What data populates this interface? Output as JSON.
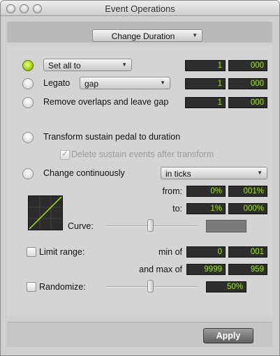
{
  "window": {
    "title": "Event Operations"
  },
  "operation": {
    "selected": "Change Duration"
  },
  "options": {
    "set_all_to": {
      "label": "Set all to",
      "value_bars": "1",
      "value_ticks": "000",
      "selected": true
    },
    "legato": {
      "label": "Legato",
      "mode": "gap",
      "value_bars": "1",
      "value_ticks": "000",
      "selected": false
    },
    "remove_overlaps": {
      "label": "Remove overlaps and leave gap",
      "value_bars": "1",
      "value_ticks": "000",
      "selected": false
    },
    "transform_sustain": {
      "label": "Transform sustain pedal to duration",
      "selected": false,
      "sub_option_label": "Delete sustain events after transform",
      "sub_option_checked": true,
      "sub_option_enabled": false
    },
    "change_continuously": {
      "label": "Change continuously",
      "unit": "in ticks",
      "selected": false,
      "from_label": "from:",
      "from_percent": "0%",
      "from_fine": "001%",
      "to_label": "to:",
      "to_percent": "1%",
      "to_fine": "000%",
      "curve_label": "Curve:"
    }
  },
  "limit_range": {
    "label": "Limit range:",
    "checked": false,
    "min_label": "min of",
    "min_value": "0",
    "min_fine": "001",
    "max_label": "and max of",
    "max_value": "9999",
    "max_fine": "959"
  },
  "randomize": {
    "label": "Randomize:",
    "checked": false,
    "value": "50%"
  },
  "footer": {
    "apply_label": "Apply"
  },
  "icons": {
    "window_buttons": [
      "close-icon",
      "minimize-icon",
      "zoom-icon"
    ],
    "dropdown": "chevron-down-icon",
    "checkmark": "checkmark-icon",
    "curve": "curve-graph-icon"
  },
  "colors": {
    "field_background": "#2e2e2e",
    "field_text": "#9cf000",
    "radio_selected": "#b4e021",
    "apply_button": "#7a7a7a"
  }
}
